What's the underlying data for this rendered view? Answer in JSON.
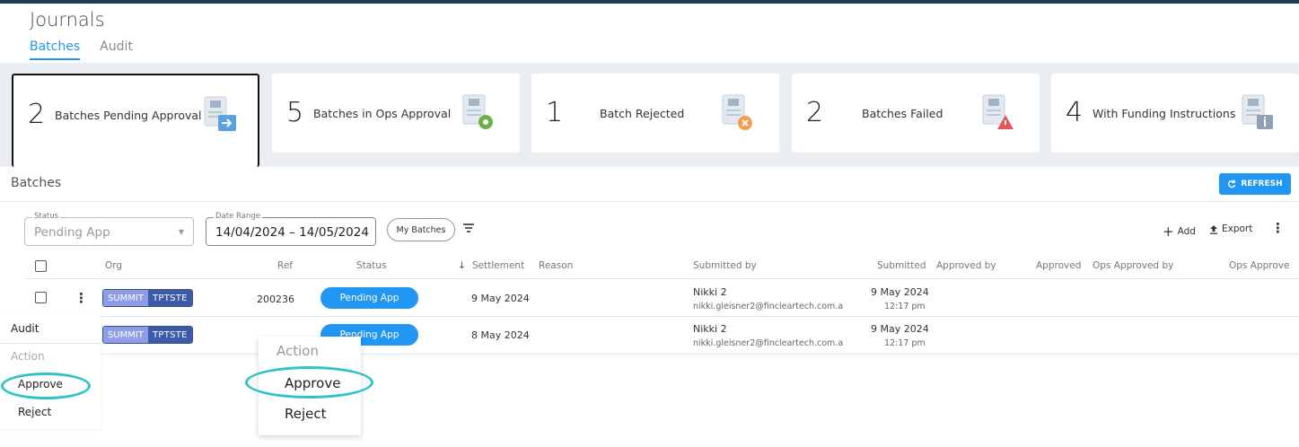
{
  "page": {
    "title": "Journals"
  },
  "tabs": [
    {
      "label": "Batches",
      "active": true
    },
    {
      "label": "Audit",
      "active": false
    }
  ],
  "cards": [
    {
      "count": "2",
      "label": "Batches Pending Approval",
      "icon": "document-arrow-icon"
    },
    {
      "count": "5",
      "label": "Batches in Ops Approval",
      "icon": "document-gear-icon"
    },
    {
      "count": "1",
      "label": "Batch Rejected",
      "icon": "document-x-icon"
    },
    {
      "count": "2",
      "label": "Batches Failed",
      "icon": "document-warning-icon"
    },
    {
      "count": "4",
      "label": "With Funding Instructions",
      "icon": "document-info-icon"
    }
  ],
  "panel": {
    "title": "Batches",
    "refresh_label": "REFRESH",
    "filters": {
      "status_label": "Status",
      "status_value": "Pending App",
      "date_label": "Date Range",
      "date_value": "14/04/2024 – 14/05/2024",
      "my_batches": "My Batches"
    },
    "toolbar": {
      "add": "Add",
      "export": "Export"
    }
  },
  "columns": [
    "Org",
    "Ref",
    "Status",
    "Settlement",
    "Reason",
    "Submitted by",
    "Submitted",
    "Approved by",
    "Approved",
    "Ops Approved by",
    "Ops Approve"
  ],
  "rows": [
    {
      "org1": "SUMMIT",
      "org2": "TPTSTE",
      "ref": "200236",
      "status": "Pending App",
      "settlement": "9 May 2024",
      "submitter": "Nikki 2",
      "submitter_email": "nikki.gleisner2@fincleartech.com.a",
      "submitted_date": "9 May 2024",
      "submitted_time": "12:17 pm"
    },
    {
      "org1": "SUMMIT",
      "org2": "TPTSTE",
      "ref": "",
      "status": "Pending App",
      "settlement": "8 May 2024",
      "submitter": "Nikki 2",
      "submitter_email": "nikki.gleisner2@fincleartech.com.a",
      "submitted_date": "9 May 2024",
      "submitted_time": "12:17 pm"
    }
  ],
  "menu_left": {
    "audit": "Audit",
    "header": "Action",
    "approve": "Approve",
    "reject": "Reject"
  },
  "menu_popup": {
    "header": "Action",
    "approve": "Approve",
    "reject": "Reject"
  },
  "colors": {
    "accent": "#2196f3",
    "highlight_ring": "#2ec4c4",
    "header_bar": "#1d3a57"
  }
}
